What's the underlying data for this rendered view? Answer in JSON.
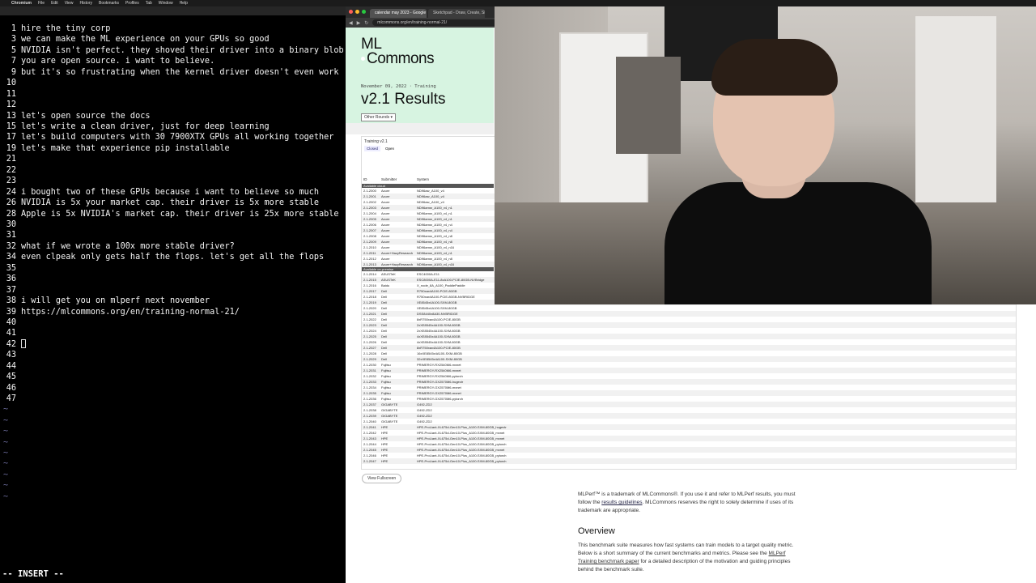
{
  "menubar": {
    "app": "Chromium",
    "items": [
      "File",
      "Edit",
      "View",
      "History",
      "Bookmarks",
      "Profiles",
      "Tab",
      "Window",
      "Help"
    ]
  },
  "terminal": {
    "mode": "-- INSERT --",
    "lines": [
      {
        "n": "1",
        "text": "hire the tiny corp"
      },
      {
        "n": "3",
        "text": "we can make the ML experience on your GPUs so good"
      },
      {
        "n": "5",
        "text": "NVIDIA isn't perfect. they shoved their driver into a binary blob"
      },
      {
        "n": "7",
        "text": "you are open source. i want to believe."
      },
      {
        "n": "9",
        "text": "but it's so frustrating when the kernel driver doesn't even work"
      },
      {
        "n": "10",
        "text": ""
      },
      {
        "n": "11",
        "text": ""
      },
      {
        "n": "12",
        "text": ""
      },
      {
        "n": "13",
        "text": "let's open source the docs"
      },
      {
        "n": "15",
        "text": "let's write a clean driver, just for deep learning"
      },
      {
        "n": "17",
        "text": "let's build computers with 30 7900XTX GPUs all working together"
      },
      {
        "n": "19",
        "text": "let's make that experience pip installable"
      },
      {
        "n": "21",
        "text": ""
      },
      {
        "n": "22",
        "text": ""
      },
      {
        "n": "23",
        "text": ""
      },
      {
        "n": "24",
        "text": "i bought two of these GPUs because i want to believe so much"
      },
      {
        "n": "26",
        "text": "NVIDIA is 5x your market cap. their driver is 5x more stable"
      },
      {
        "n": "28",
        "text": "Apple is 5x NVIDIA's market cap. their driver is 25x more stable"
      },
      {
        "n": "30",
        "text": ""
      },
      {
        "n": "31",
        "text": ""
      },
      {
        "n": "32",
        "text": "what if we wrote a 100x more stable driver?"
      },
      {
        "n": "34",
        "text": "even clpeak only gets half the flops. let's get all the flops"
      },
      {
        "n": "35",
        "text": ""
      },
      {
        "n": "36",
        "text": ""
      },
      {
        "n": "37",
        "text": ""
      },
      {
        "n": "38",
        "text": "i will get you on mlperf next november"
      },
      {
        "n": "39",
        "text": "https://mlcommons.org/en/training-normal-21/"
      },
      {
        "n": "40",
        "text": ""
      },
      {
        "n": "41",
        "text": ""
      },
      {
        "n": "42",
        "text": ""
      },
      {
        "n": "43",
        "text": ""
      },
      {
        "n": "44",
        "text": ""
      },
      {
        "n": "45",
        "text": ""
      },
      {
        "n": "46",
        "text": ""
      },
      {
        "n": "47",
        "text": ""
      }
    ]
  },
  "browser": {
    "tabs": [
      "calendar may 2023 - Google",
      "Sketchpad - Draw, Create, Sh"
    ],
    "url": "mlcommons.org/en/training-normal-21/",
    "logo_line1": "ML",
    "logo_line2": "Commons",
    "date": "November 09, 2022 · Training",
    "title": "v2.1 Results",
    "rounds_button": "Other Rounds ▾",
    "table_caption": "Training v2.1",
    "table_tabs": [
      "Closed",
      "Open"
    ],
    "headers": [
      "ID",
      "Submitter",
      "System"
    ],
    "section_available": "Available cloud",
    "section_onprem": "Available on-premise",
    "rows": [
      [
        "2.1-2000",
        "Azure",
        "ND96asr_A100_v4"
      ],
      [
        "2.1-2001",
        "Azure",
        "ND96asr_A100_v4"
      ],
      [
        "2.1-2002",
        "Azure",
        "ND96asr_A100_v4"
      ],
      [
        "2.1-2003",
        "Azure",
        "ND96amsr_A100_v4_n1"
      ],
      [
        "2.1-2004",
        "Azure",
        "ND96amsr_A100_v4_n1"
      ],
      [
        "2.1-2005",
        "Azure",
        "ND96amsr_A100_v4_n1"
      ],
      [
        "2.1-2006",
        "Azure",
        "ND96amsr_A100_v4_n4"
      ],
      [
        "2.1-2007",
        "Azure",
        "ND96amsr_A100_v4_n4"
      ],
      [
        "2.1-2008",
        "Azure",
        "ND96amsr_A100_v4_n8"
      ],
      [
        "2.1-2009",
        "Azure",
        "ND96amsr_A100_v4_n8"
      ],
      [
        "2.1-2010",
        "Azure",
        "ND96amsr_A100_v4_n16"
      ],
      [
        "2.1-2011",
        "Azure+HazyResearch",
        "ND96amsr_A100_v4_n1"
      ],
      [
        "2.1-2012",
        "Azure",
        "ND96amsr_A100_v4_n8"
      ],
      [
        "2.1-2013",
        "Azure+HazyResearch",
        "ND96amsr_A100_v4_n16"
      ]
    ],
    "rows_onprem": [
      [
        "2.1-2014",
        "ASUSTeK",
        "ESC4000A-E11"
      ],
      [
        "2.1-2015",
        "ASUSTeK",
        "ESC8000A-E11-8xA100-PCIE-80GB-NVBridge"
      ],
      [
        "2.1-2016",
        "Baidu",
        "X_node_8A_A100_PaddlePaddle"
      ],
      [
        "2.1-2017",
        "Dell",
        "R750xax4A100-PCIE-80GB"
      ],
      [
        "2.1-2018",
        "Dell",
        "R750xax4A100-PCIE-80GB-NVBRIDGE"
      ],
      [
        "2.1-2019",
        "Dell",
        "XE8545x4A100-SXM-80GB"
      ],
      [
        "2.1-2020",
        "Dell",
        "XE8545x4A100-SXM-80GB"
      ],
      [
        "2.1-2021",
        "Dell",
        "DSS8440x8A30-NVBRIDGE"
      ],
      [
        "2.1-2022",
        "Dell",
        "8xR750xax4A100-PCIE-80GB"
      ],
      [
        "2.1-2023",
        "Dell",
        "2xXE8545x4A100-SXM-80GB"
      ],
      [
        "2.1-2024",
        "Dell",
        "2xXE8545x4A100-SXM-80GB"
      ],
      [
        "2.1-2025",
        "Dell",
        "4xXE8545x4A100-SXM-80GB"
      ],
      [
        "2.1-2026",
        "Dell",
        "4xXE8545x4A100-SXM-80GB"
      ],
      [
        "2.1-2027",
        "Dell",
        "8xR750xax4A100-PCIE-80GB"
      ],
      [
        "2.1-2028",
        "Dell",
        "16xXE8545x4A100-SXM-80GB"
      ],
      [
        "2.1-2029",
        "Dell",
        "32xXE8545x4A100-SXM-80GB"
      ],
      [
        "2.1-2030",
        "Fujitsu",
        "PRIMERGY-RX2540M6-mxnet"
      ],
      [
        "2.1-2031",
        "Fujitsu",
        "PRIMERGY-RX2540M6-mxnet"
      ],
      [
        "2.1-2032",
        "Fujitsu",
        "PRIMERGY-RX2540M6-pytorch"
      ],
      [
        "2.1-2033",
        "Fujitsu",
        "PRIMERGY-GX2570M6-hugectr"
      ],
      [
        "2.1-2034",
        "Fujitsu",
        "PRIMERGY-GX2570M6-mxnet"
      ],
      [
        "2.1-2035",
        "Fujitsu",
        "PRIMERGY-GX2570M6-mxnet"
      ],
      [
        "2.1-2036",
        "Fujitsu",
        "PRIMERGY-GX2570M6-pytorch"
      ],
      [
        "2.1-2037",
        "GIGABYTE",
        "G492-ZD2"
      ],
      [
        "2.1-2038",
        "GIGABYTE",
        "G492-ZD2"
      ],
      [
        "2.1-2039",
        "GIGABYTE",
        "G492-ZD2"
      ],
      [
        "2.1-2040",
        "GIGABYTE",
        "G492-ZD2"
      ],
      [
        "2.1-2041",
        "HPE",
        "HPE-ProLiant-XL675d-Gen10-Plus_A100-SXM-80GB_hugectr"
      ],
      [
        "2.1-2042",
        "HPE",
        "HPE-ProLiant-XL675d-Gen10-Plus_A100-SXM-80GB_mxnet"
      ],
      [
        "2.1-2043",
        "HPE",
        "HPE-ProLiant-XL675d-Gen10-Plus_A100-SXM-80GB_mxnet"
      ],
      [
        "2.1-2044",
        "HPE",
        "HPE-ProLiant-XL675d-Gen10-Plus_A100-SXM-80GB_pytorch"
      ],
      [
        "2.1-2045",
        "HPE",
        "HPE-ProLiant-XL675d-Gen10-Plus_A100-SXM-80GB_mxnet"
      ],
      [
        "2.1-2046",
        "HPE",
        "HPE-ProLiant-XL675d-Gen10-Plus_A100-SXM-80GB_pytorch"
      ],
      [
        "2.1-2047",
        "HPE",
        "HPE-ProLiant-XL675d-Gen10-Plus_A100-SXM-80GB_pytorch"
      ]
    ],
    "fullscreen_button": "View Fullscreen",
    "trademark_pre": "MLPerf™ is a trademark of MLCommons®. If you use it and refer to MLPerf results, you must follow the ",
    "trademark_link": "results guidelines",
    "trademark_post": ". MLCommons reserves the right to solely determine if uses of its trademark are appropriate.",
    "overview_heading": "Overview",
    "overview_pre": "This benchmark suite measures how fast systems can train models to a target quality metric. Below is a short summary of the current benchmarks and metrics. Please see the ",
    "overview_link": "MLPerf Training benchmark paper",
    "overview_post": " for a detailed description of the motivation and guiding principles behind the benchmark suite."
  },
  "colors": {
    "hero_bg": "#d7f4e1",
    "section_bar": "#555555",
    "vim_tilde": "#6a6a9a"
  }
}
